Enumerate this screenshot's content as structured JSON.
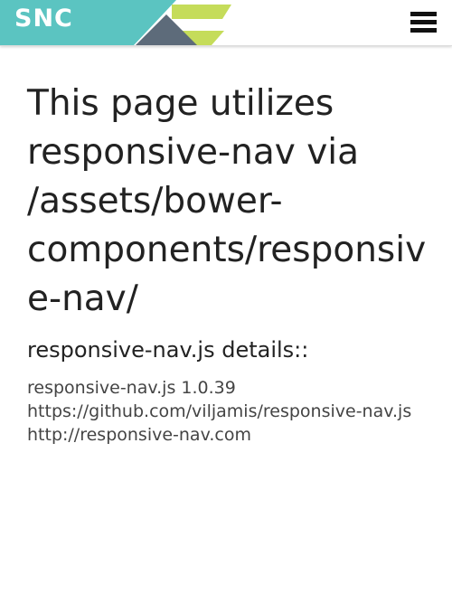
{
  "header": {
    "logo_text": "SNC",
    "menu_icon": "hamburger-menu-icon"
  },
  "colors": {
    "teal": "#5bc4c1",
    "lime": "#c5dc5a",
    "slate": "#5d6b7a",
    "text": "#222222"
  },
  "main": {
    "title": "This page utilizes responsive-nav via /assets/bower-components/responsive-nav/",
    "details_heading": "responsive-nav.js details::",
    "details": {
      "version": "responsive-nav.js 1.0.39",
      "repo": "https://github.com/viljamis/responsive-nav.js",
      "site": "http://responsive-nav.com"
    }
  }
}
